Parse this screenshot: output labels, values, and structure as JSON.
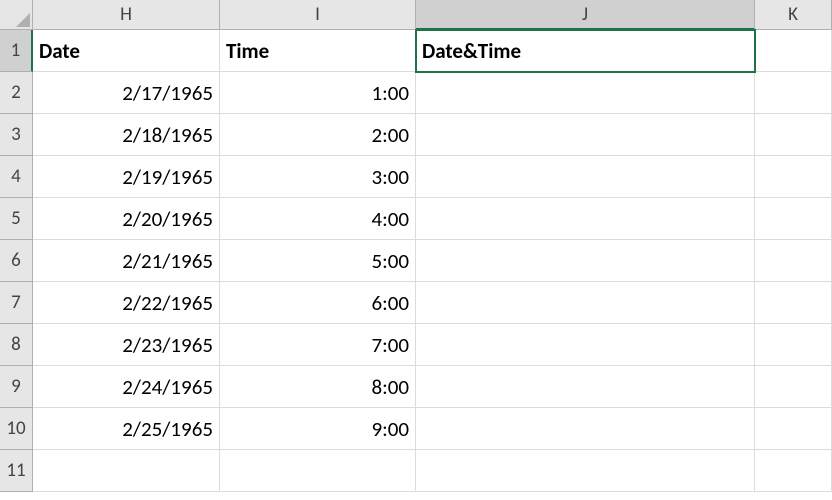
{
  "columns": [
    "H",
    "I",
    "J",
    "K"
  ],
  "selected_column_index": 2,
  "selected_row_index": 0,
  "active_cell": "J1",
  "headers": {
    "H": "Date",
    "I": "Time",
    "J": "Date&Time",
    "K": ""
  },
  "rows": [
    {
      "n": "1",
      "H": "Date",
      "I": "Time",
      "J": "Date&Time",
      "K": "",
      "is_header_row": true
    },
    {
      "n": "2",
      "H": "2/17/1965",
      "I": "1:00",
      "J": "",
      "K": ""
    },
    {
      "n": "3",
      "H": "2/18/1965",
      "I": "2:00",
      "J": "",
      "K": ""
    },
    {
      "n": "4",
      "H": "2/19/1965",
      "I": "3:00",
      "J": "",
      "K": ""
    },
    {
      "n": "5",
      "H": "2/20/1965",
      "I": "4:00",
      "J": "",
      "K": ""
    },
    {
      "n": "6",
      "H": "2/21/1965",
      "I": "5:00",
      "J": "",
      "K": ""
    },
    {
      "n": "7",
      "H": "2/22/1965",
      "I": "6:00",
      "J": "",
      "K": ""
    },
    {
      "n": "8",
      "H": "2/23/1965",
      "I": "7:00",
      "J": "",
      "K": ""
    },
    {
      "n": "9",
      "H": "2/24/1965",
      "I": "8:00",
      "J": "",
      "K": ""
    },
    {
      "n": "10",
      "H": "2/25/1965",
      "I": "9:00",
      "J": "",
      "K": ""
    },
    {
      "n": "11",
      "H": "",
      "I": "",
      "J": "",
      "K": ""
    }
  ]
}
